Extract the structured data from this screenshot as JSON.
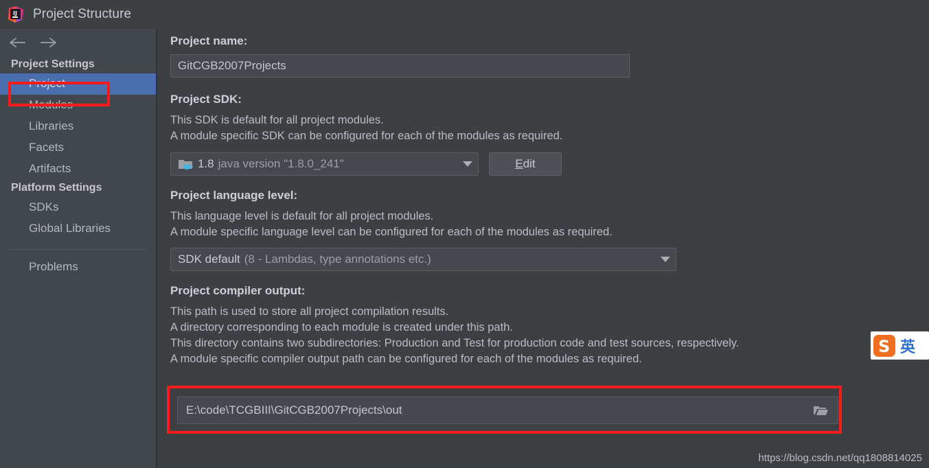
{
  "window": {
    "title": "Project Structure",
    "app_icon": "intellij-idea-logo"
  },
  "sidebar": {
    "back_icon": "arrow-left-icon",
    "forward_icon": "arrow-right-icon",
    "groups": [
      {
        "heading": "Project Settings",
        "items": [
          {
            "label": "Project",
            "selected": true
          },
          {
            "label": "Modules",
            "selected": false
          },
          {
            "label": "Libraries",
            "selected": false
          },
          {
            "label": "Facets",
            "selected": false
          },
          {
            "label": "Artifacts",
            "selected": false
          }
        ]
      },
      {
        "heading": "Platform Settings",
        "items": [
          {
            "label": "SDKs",
            "selected": false
          },
          {
            "label": "Global Libraries",
            "selected": false
          }
        ]
      }
    ],
    "problems_label": "Problems"
  },
  "main": {
    "project_name": {
      "label": "Project name:",
      "value": "GitCGB2007Projects",
      "placeholder": "Project name"
    },
    "project_sdk": {
      "label": "Project SDK:",
      "description_lines": [
        "This SDK is default for all project modules.",
        "A module specific SDK can be configured for each of the modules as required."
      ],
      "selected_version": "1.8",
      "selected_detail": "java version \"1.8.0_241\"",
      "sdk_icon": "folder-java-icon",
      "caret_icon": "chevron-down-icon",
      "edit_button": {
        "prefix": "",
        "mnemonic": "E",
        "suffix": "dit"
      }
    },
    "language_level": {
      "label": "Project language level:",
      "description_lines": [
        "This language level is default for all project modules.",
        "A module specific language level can be configured for each of the modules as required."
      ],
      "selected_main": "SDK default",
      "selected_detail": "(8 - Lambdas, type annotations etc.)",
      "caret_icon": "chevron-down-icon"
    },
    "compiler_output": {
      "label": "Project compiler output:",
      "description_lines": [
        "This path is used to store all project compilation results.",
        "A directory corresponding to each module is created under this path.",
        "This directory contains two subdirectories: Production and Test for production code and test sources, respectively.",
        "A module specific compiler output path can be configured for each of the modules as required."
      ],
      "value": "E:\\code\\TCGBIII\\GitCGB2007Projects\\out",
      "placeholder": "Compiler output path",
      "browse_icon": "folder-open-icon"
    }
  },
  "annotations": {
    "highlight_color": "#fb1b1b",
    "boxes": [
      {
        "target": "sidebar-item-project"
      },
      {
        "target": "compiler-output-field"
      }
    ]
  },
  "ime_badge": {
    "logo_icon": "sogou-logo-icon",
    "mode_label": "英",
    "logo_color": "#f06e20",
    "mode_color": "#2f6fd0"
  },
  "watermark": {
    "text": "https://blog.csdn.net/qq1808814025"
  },
  "colors": {
    "background": "#3c4043",
    "sidebar": "#42464d",
    "selection": "#4b6eaf",
    "field_bg": "#45494e",
    "text": "#b9bec4"
  }
}
